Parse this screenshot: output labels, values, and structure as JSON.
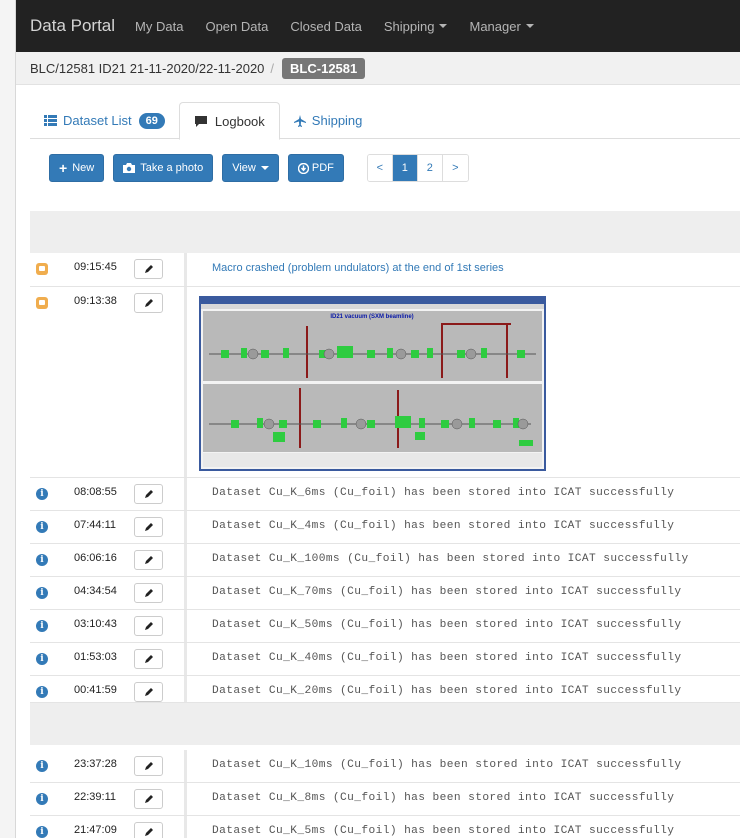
{
  "navbar": {
    "brand": "Data Portal",
    "items": [
      "My Data",
      "Open Data",
      "Closed Data",
      "Shipping",
      "Manager"
    ]
  },
  "breadcrumb": {
    "path": "BLC/12581 ID21 21-11-2020/22-11-2020",
    "separator": "/",
    "badge": "BLC-12581"
  },
  "tabs": [
    {
      "label": "Dataset List",
      "count": "69",
      "icon": "list-icon"
    },
    {
      "label": "Logbook",
      "icon": "comment-icon"
    },
    {
      "label": "Shipping",
      "icon": "plane-icon"
    }
  ],
  "toolbar": {
    "new_label": "New",
    "photo_label": "Take a photo",
    "view_label": "View",
    "pdf_label": "PDF",
    "pager": [
      "<",
      "1",
      "2",
      ">"
    ],
    "current_page": "1"
  },
  "entries": [
    {
      "type": "note",
      "time": "09:15:45",
      "text": "Macro crashed (problem undulators) at the end of 1st series"
    },
    {
      "type": "note",
      "time": "09:13:38",
      "text": ""
    },
    {
      "type": "info",
      "time": "08:08:55",
      "text": "Dataset Cu_K_6ms (Cu_foil) has been stored into ICAT successfully"
    },
    {
      "type": "info",
      "time": "07:44:11",
      "text": "Dataset Cu_K_4ms (Cu_foil) has been stored into ICAT successfully"
    },
    {
      "type": "info",
      "time": "06:06:16",
      "text": "Dataset Cu_K_100ms (Cu_foil) has been stored into ICAT successfully"
    },
    {
      "type": "info",
      "time": "04:34:54",
      "text": "Dataset Cu_K_70ms (Cu_foil) has been stored into ICAT successfully"
    },
    {
      "type": "info",
      "time": "03:10:43",
      "text": "Dataset Cu_K_50ms (Cu_foil) has been stored into ICAT successfully"
    },
    {
      "type": "info",
      "time": "01:53:03",
      "text": "Dataset Cu_K_40ms (Cu_foil) has been stored into ICAT successfully"
    },
    {
      "type": "info",
      "time": "00:41:59",
      "text": "Dataset Cu_K_20ms (Cu_foil) has been stored into ICAT successfully"
    },
    {
      "type": "info",
      "time": "23:37:28",
      "text": "Dataset Cu_K_10ms (Cu_foil) has been stored into ICAT successfully"
    },
    {
      "type": "info",
      "time": "22:39:11",
      "text": "Dataset Cu_K_8ms (Cu_foil) has been stored into ICAT successfully"
    },
    {
      "type": "info",
      "time": "21:47:09",
      "text": "Dataset Cu_K_5ms (Cu_foil) has been stored into ICAT successfully"
    }
  ],
  "screenshot_caption": "ID21 vacuum (SXM beamline)",
  "colors": {
    "navbar": "#222222",
    "primary": "#337ab7",
    "note": "#f0ad4e",
    "badge": "#777777"
  }
}
